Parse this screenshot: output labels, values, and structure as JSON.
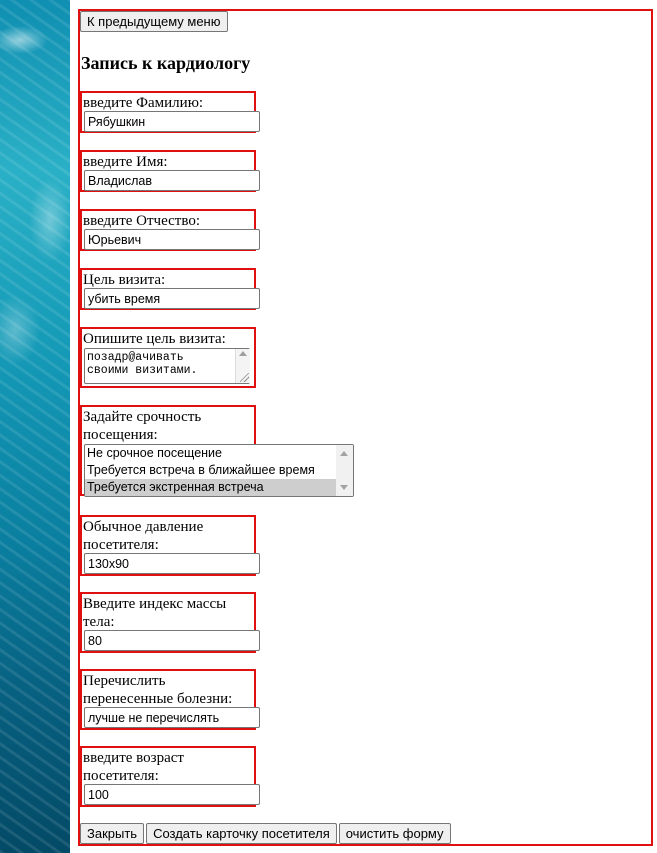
{
  "nav": {
    "back_label": "К предыдущему меню"
  },
  "page": {
    "title": "Запись к кардиологу"
  },
  "fields": {
    "last_name": {
      "label": "введите Фамилию:",
      "value": "Рябушкин"
    },
    "first_name": {
      "label": "введите Имя:",
      "value": "Владислав"
    },
    "patronymic": {
      "label": "введите Отчество:",
      "value": "Юрьевич"
    },
    "visit_purpose": {
      "label": "Цель визита:",
      "value": "убить время"
    },
    "visit_description": {
      "label": "Опишите цель визита:",
      "value": "позадр@ачивать\nсвоими визитами."
    },
    "urgency": {
      "label_line1": "Задайте срочность",
      "label_line2": "посещения:",
      "options": [
        "Не срочное посещение",
        "Требуется встреча в ближайшее время",
        "Требуется экстренная встреча"
      ],
      "selected": "Требуется экстренная встреча"
    },
    "pressure": {
      "label_line1": "Обычное давление",
      "label_line2": "посетителя:",
      "value": "130x90"
    },
    "bmi": {
      "label_line1": "Введите индекс массы",
      "label_line2": "тела:",
      "value": "80"
    },
    "diseases": {
      "label_line1": "Перечислить",
      "label_line2": "перенесенные болезни:",
      "value": "лучше не перечислять"
    },
    "age": {
      "label_line1": "введите возраст",
      "label_line2": "посетителя:",
      "value": "100"
    }
  },
  "actions": {
    "close_label": "Закрыть",
    "create_label": "Создать карточку посетителя",
    "clear_label": "очистить форму"
  },
  "colors": {
    "frame_border": "#e01010",
    "selected_option": "#cecece"
  }
}
